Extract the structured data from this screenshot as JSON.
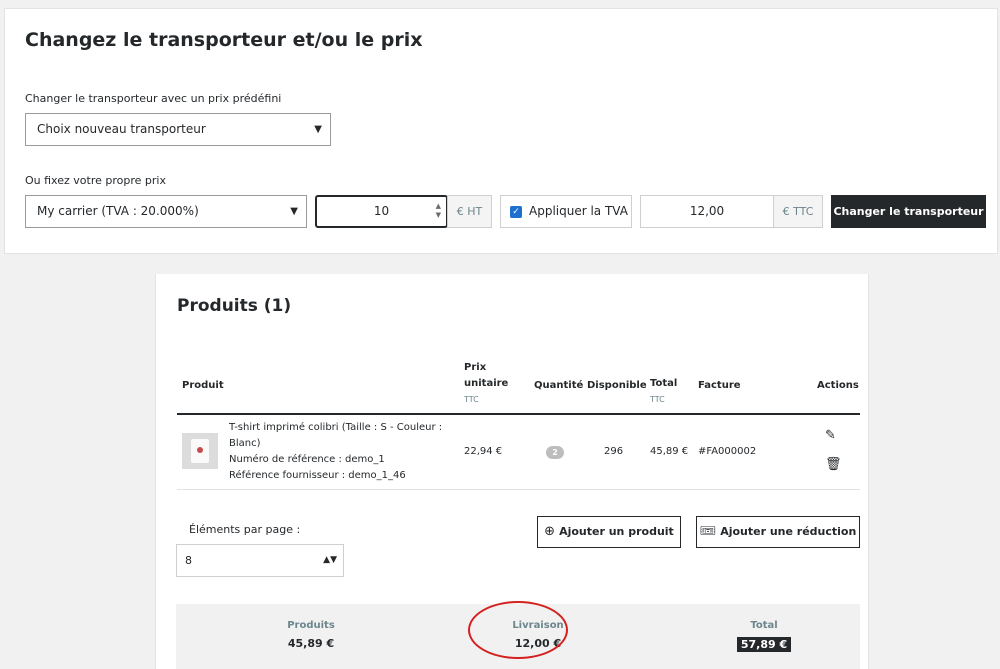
{
  "carrier": {
    "title": "Changez le transporteur et/ou le prix",
    "predefined_label": "Changer le transporteur avec un prix prédéfini",
    "predefined_select": "Choix nouveau transporteur",
    "own_price_label": "Ou fixez votre propre prix",
    "carrier_select": "My carrier (TVA : 20.000%)",
    "price_ht_value": "10",
    "price_ht_addon": "€ HT",
    "apply_tax_label": "Appliquer la TVA",
    "apply_tax_checked": true,
    "price_ttc_value": "12,00",
    "price_ttc_addon": "€ TTC",
    "submit_label": "Changer le transporteur"
  },
  "products": {
    "title": "Produits (1)",
    "columns": {
      "product": "Produit",
      "unit_price": "Prix unitaire",
      "unit_price_sub": "TTC",
      "quantity": "Quantité",
      "available": "Disponible",
      "total": "Total",
      "total_sub": "TTC",
      "invoice": "Facture",
      "actions": "Actions"
    },
    "rows": [
      {
        "name_line1": "T-shirt imprimé colibri (Taille : S - Couleur :",
        "name_line2": "Blanc)",
        "reference": "Numéro de référence : demo_1",
        "supplier_reference": "Référence fournisseur : demo_1_46",
        "unit_price": "22,94 €",
        "quantity": "2",
        "available": "296",
        "total": "45,89 €",
        "invoice": "#FA000002"
      }
    ],
    "per_page_label": "Éléments par page :",
    "per_page_value": "8",
    "add_product_label": "Ajouter un produit",
    "add_discount_label": "Ajouter une réduction"
  },
  "summary": {
    "products_label": "Produits",
    "products_value": "45,89 €",
    "shipping_label": "Livraison",
    "shipping_value": "12,00 €",
    "total_label": "Total",
    "total_value": "57,89 €"
  },
  "colors": {
    "dark": "#25282b",
    "accent_checkbox": "#1e6fd0",
    "highlight_circle": "#d42020"
  }
}
